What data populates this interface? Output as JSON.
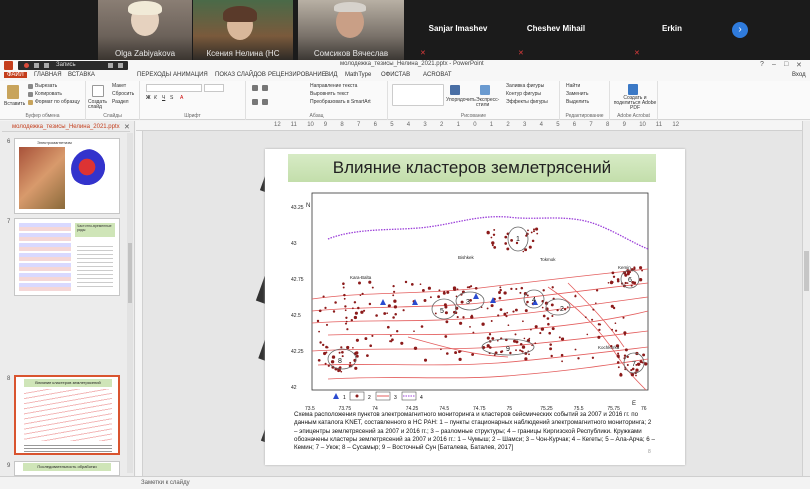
{
  "participants": [
    {
      "name": "Olga Zabiyakova",
      "camera": true
    },
    {
      "name": "Ксения Нелина (НС",
      "camera": true
    },
    {
      "name": "Сомсиков Вячеслав",
      "camera": true
    },
    {
      "name": "Sanjar Imashev",
      "camera": false
    },
    {
      "name": "Cheshev Mihail",
      "camera": false
    },
    {
      "name": "Erkin",
      "camera": false
    }
  ],
  "window": {
    "title": "молодежка_тезисы_Нелина_2021.pptx - PowerPoint",
    "qat_label": "Запись",
    "sign_in": "Вход"
  },
  "tabs": [
    "ФАЙЛ",
    "ГЛАВНАЯ",
    "ВСТАВКА",
    "ПЕРЕХОДЫ",
    "АНИМАЦИЯ",
    "ПОКАЗ СЛАЙДОВ",
    "РЕЦЕНЗИРОВАНИЕ",
    "ВИД",
    "MathType",
    "ОФИСТАВ",
    "ACROBAT"
  ],
  "ribbon": {
    "paste": "Вставить",
    "cut": "Вырезать",
    "copy": "Копировать",
    "format_painter": "Формат по образцу",
    "clipboard": "Буфер обмена",
    "new_slide": "Создать слайд",
    "layout": "Макет",
    "reset": "Сбросить",
    "section": "Раздел",
    "slides": "Слайды",
    "font": "Шрифт",
    "paragraph": "Абзац",
    "text_direction": "Направление текста",
    "align_text": "Выровнять текст",
    "smartart": "Преобразовать в SmartArt",
    "arrange": "Упорядочить",
    "quick_styles": "Экспресс-стили",
    "shape_fill": "Заливка фигуры",
    "shape_outline": "Контур фигуры",
    "shape_effects": "Эффекты фигуры",
    "drawing": "Рисование",
    "find": "Найти",
    "replace": "Заменить",
    "select": "Выделить",
    "editing": "Редактирование",
    "acrobat_btn": "Создать и поделиться Adobe PDF",
    "acrobat_grp": "Adobe Acrobat"
  },
  "file_tab": "молодежка_тезисы_Нелина_2021.pptx",
  "thumbs": [
    {
      "num": "6",
      "title": "Электромагнетизм"
    },
    {
      "num": "7",
      "title": "Частотно-временные ряды"
    },
    {
      "num": "8",
      "title": "Влияние кластеров землетрясений"
    },
    {
      "num": "9",
      "title": "Последовательность обработки"
    }
  ],
  "ruler": [
    "12",
    "11",
    "10",
    "9",
    "8",
    "7",
    "6",
    "5",
    "4",
    "3",
    "2",
    "1",
    "0",
    "1",
    "2",
    "3",
    "4",
    "5",
    "6",
    "7",
    "8",
    "9",
    "10",
    "11",
    "12"
  ],
  "slide": {
    "title": "Влияние кластеров землетрясений",
    "map": {
      "yticks": [
        "43.25",
        "43",
        "42.75",
        "42.5",
        "42.25",
        "42"
      ],
      "xticks": [
        "73.5",
        "73.75",
        "74",
        "74.25",
        "74.5",
        "74.75",
        "75",
        "75.25",
        "75.5",
        "75.75",
        "76"
      ],
      "n_label": "N",
      "e_label": "E",
      "places": [
        "Bishkek",
        "Tokmok",
        "Kara-Balta",
        "Kemin",
        "Kochkorka"
      ],
      "clusters": [
        "1",
        "2",
        "3",
        "4",
        "5",
        "6",
        "7",
        "8",
        "9"
      ],
      "legend": [
        "1",
        "2",
        "3",
        "4"
      ]
    },
    "caption": "Схема расположения пунктов электромагнитного мониторинга и кластеров сейсмических событий за 2007 и 2016 гг. по данным каталога KNET, составленного в НС РАН: 1 – пункты стационарных наблюдений электромагнитного мониторинга; 2 – эпицентры землетрясений за 2007 и 2016 гг.; 3 – разломные структуры; 4 – границы Киргизской Республики. Кружками обозначены кластеры землетрясений за 2007 и 2016 гг.: 1 – Чумыш; 2 – Шамси; 3 – Чон-Курчак; 4 – Кегеты; 5 – Ала-Арча; 6 – Кемин; 7 – Укок; 8 – Сусамыр; 9 – Восточный Сун [Баталева, Баталев, 2017]",
    "page_num": "8"
  },
  "notes": "Заметки к слайду"
}
